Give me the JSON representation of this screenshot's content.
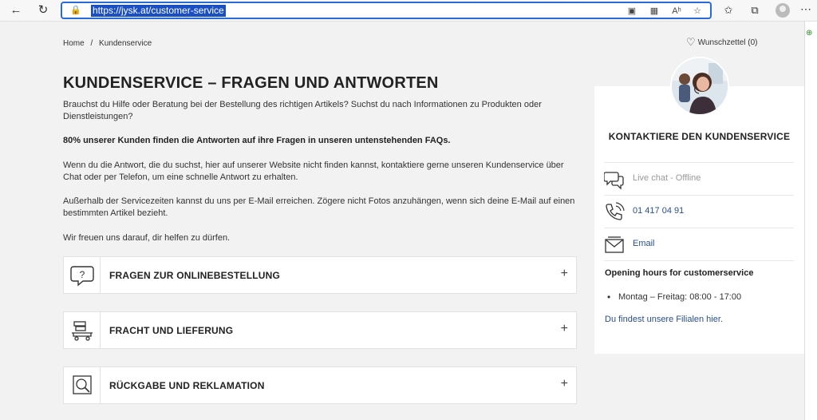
{
  "browser": {
    "url": "https://jysk.at/customer-service",
    "reader_icon_text": "Aʰ"
  },
  "breadcrumb": {
    "home": "Home",
    "separator": "/",
    "current": "Kundenservice"
  },
  "wishlist": {
    "label": "Wunschzettel (0)"
  },
  "main": {
    "title": "KUNDENSERVICE – FRAGEN UND ANTWORTEN",
    "intro": "Brauchst du Hilfe oder Beratung bei der Bestellung des richtigen Artikels? Suchst du nach Informationen zu Produkten oder Dienstleistungen?",
    "highlight": "80% unserer Kunden finden die Antworten auf ihre Fragen in unseren untenstehenden FAQs.",
    "contact_text": "Wenn du die Antwort, die du suchst, hier auf unserer Website nicht finden kannst, kontaktiere gerne unseren Kundenservice über Chat oder per Telefon, um eine schnelle Antwort zu erhalten.",
    "email_text": "Außerhalb der Servicezeiten kannst du uns per E-Mail erreichen. Zögere nicht Fotos anzuhängen, wenn sich deine E-Mail auf einen bestimmten Artikel bezieht.",
    "closing": "Wir freuen uns darauf, dir helfen zu dürfen."
  },
  "faqs": [
    {
      "label": "FRAGEN ZUR ONLINEBESTELLUNG",
      "icon": "question-bubble-icon",
      "toggle": "+"
    },
    {
      "label": "FRACHT UND LIEFERUNG",
      "icon": "delivery-cart-icon",
      "toggle": "+"
    },
    {
      "label": "RÜCKGABE UND REKLAMATION",
      "icon": "return-inspect-icon",
      "toggle": "+"
    }
  ],
  "contact": {
    "title": "KONTAKTIERE DEN KUNDENSERVICE",
    "chat": "Live chat - Offline",
    "phone": "01 417 04 91",
    "email": "Email",
    "hours_title": "Opening hours for customerservice",
    "hours": [
      "Montag – Freitag: 08:00 - 17:00"
    ],
    "stores_link": "Du findest unsere Filialen hier."
  },
  "colors": {
    "accent_blue": "#2a4f8a",
    "url_highlight": "#1a4fc4",
    "background": "#f2f2f2"
  }
}
